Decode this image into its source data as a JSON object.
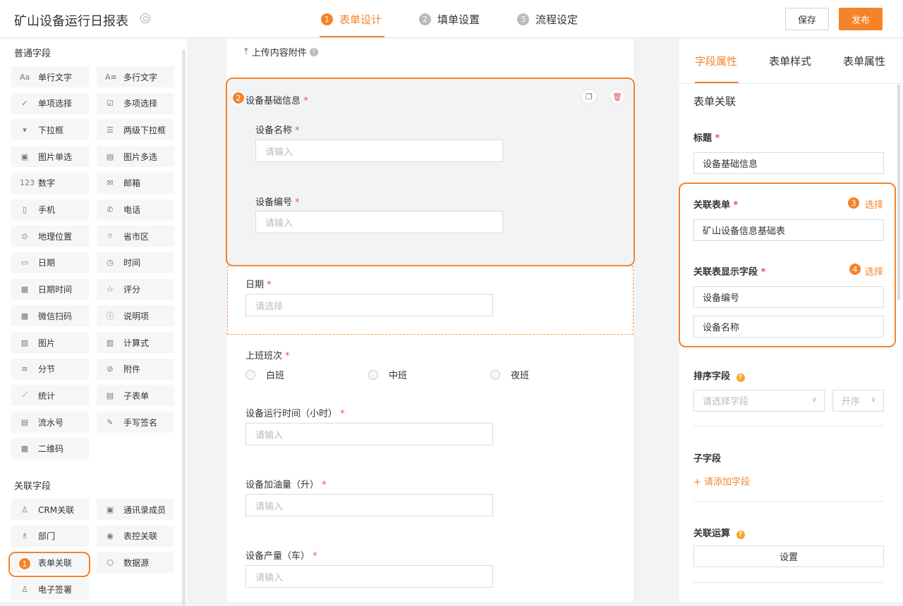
{
  "header": {
    "app_title": "矿山设备运行日报表",
    "steps": [
      {
        "num": "1",
        "label": "表单设计"
      },
      {
        "num": "2",
        "label": "填单设置"
      },
      {
        "num": "3",
        "label": "流程设定"
      }
    ],
    "save_label": "保存",
    "publish_label": "发布"
  },
  "left": {
    "common_title": "普通字段",
    "common_fields": [
      {
        "icon": "Aa",
        "label": "单行文字"
      },
      {
        "icon": "A≡",
        "label": "多行文字"
      },
      {
        "icon": "✓",
        "label": "单项选择"
      },
      {
        "icon": "☑",
        "label": "多项选择"
      },
      {
        "icon": "▾",
        "label": "下拉框"
      },
      {
        "icon": "☰",
        "label": "两级下拉框"
      },
      {
        "icon": "▣",
        "label": "图片单选"
      },
      {
        "icon": "▤",
        "label": "图片多选"
      },
      {
        "icon": "123",
        "label": "数字"
      },
      {
        "icon": "✉",
        "label": "邮箱"
      },
      {
        "icon": "▯",
        "label": "手机"
      },
      {
        "icon": "✆",
        "label": "电话"
      },
      {
        "icon": "⊙",
        "label": "地理位置"
      },
      {
        "icon": "⌾",
        "label": "省市区"
      },
      {
        "icon": "▭",
        "label": "日期"
      },
      {
        "icon": "◷",
        "label": "时间"
      },
      {
        "icon": "▦",
        "label": "日期时间"
      },
      {
        "icon": "☆",
        "label": "评分"
      },
      {
        "icon": "▩",
        "label": "微信扫码"
      },
      {
        "icon": "ⓘ",
        "label": "说明项"
      },
      {
        "icon": "▨",
        "label": "图片"
      },
      {
        "icon": "▥",
        "label": "计算式"
      },
      {
        "icon": "≡",
        "label": "分节"
      },
      {
        "icon": "⊘",
        "label": "附件"
      },
      {
        "icon": "⟋",
        "label": "统计"
      },
      {
        "icon": "▤",
        "label": "子表单"
      },
      {
        "icon": "▤",
        "label": "流水号"
      },
      {
        "icon": "✎",
        "label": "手写签名"
      },
      {
        "icon": "▩",
        "label": "二维码"
      }
    ],
    "related_title": "关联字段",
    "related_fields": [
      {
        "icon": "♙",
        "label": "CRM关联"
      },
      {
        "icon": "▣",
        "label": "通讯录成员"
      },
      {
        "icon": "♗",
        "label": "部门"
      },
      {
        "icon": "◉",
        "label": "表控关联"
      },
      {
        "icon": "",
        "label": "表单关联"
      },
      {
        "icon": "⬡",
        "label": "数据源"
      },
      {
        "icon": "♙",
        "label": "电子签署"
      }
    ],
    "callout": "1"
  },
  "canvas": {
    "upload_label": "上传内容附件",
    "group_callout": "2",
    "group_title": "设备基础信息",
    "device_name_label": "设备名称",
    "device_name_placeholder": "请输入",
    "device_no_label": "设备编号",
    "device_no_placeholder": "请输入",
    "date_label": "日期",
    "date_placeholder": "请选择",
    "shift_label": "上班班次",
    "shifts": [
      "白班",
      "中班",
      "夜班"
    ],
    "runtime_label": "设备运行时间（小时）",
    "runtime_placeholder": "请输入",
    "fuel_label": "设备加油量（升）",
    "fuel_placeholder": "请输入",
    "output_label": "设备产量（车）",
    "output_placeholder": "请输入",
    "required_mark": "*"
  },
  "right": {
    "tabs": [
      "字段属性",
      "表单样式",
      "表单属性"
    ],
    "section_title": "表单关联",
    "title_label": "标题",
    "title_value": "设备基础信息",
    "rel_form_label": "关联表单",
    "rel_form_link": "选择",
    "rel_form_callout": "3",
    "rel_form_value": "矿山设备信息基础表",
    "rel_display_label": "关联表显示字段",
    "rel_display_link": "选择",
    "rel_display_callout": "4",
    "display_fields": [
      "设备编号",
      "设备名称"
    ],
    "sort_label": "排序字段",
    "sort_placeholder": "请选择字段",
    "sort_order": "升序",
    "subfield_label": "子字段",
    "add_subfield": "+ 请添加字段",
    "calc_label": "关联运算",
    "calc_button": "设置"
  },
  "colors": {
    "accent": "#f5832a",
    "required": "#f04e4e"
  }
}
